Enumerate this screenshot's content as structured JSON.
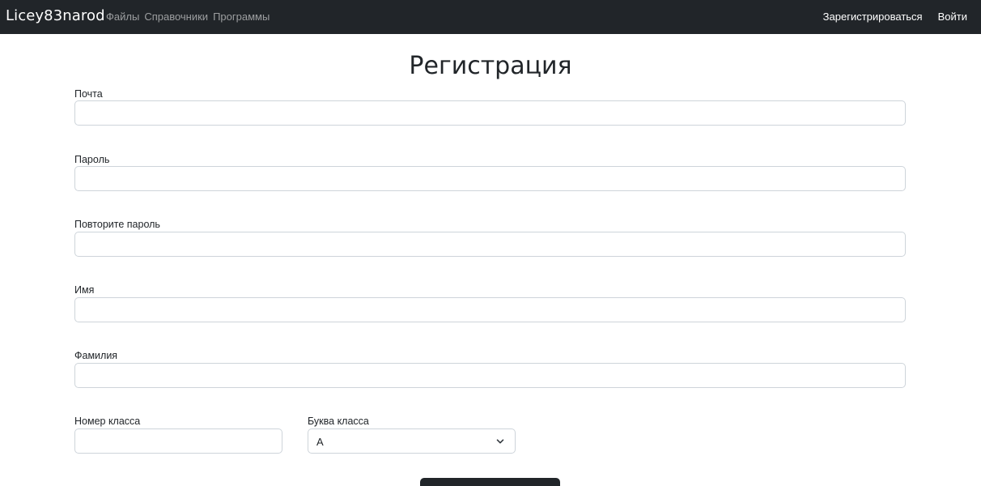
{
  "navbar": {
    "brand": "Licey83narod",
    "links": [
      "Файлы",
      "Справочники",
      "Программы"
    ],
    "register_label": "Зарегистрироваться",
    "login_label": "Войти"
  },
  "page": {
    "title": "Регистрация"
  },
  "form": {
    "email": {
      "label": "Почта",
      "value": ""
    },
    "password": {
      "label": "Пароль",
      "value": ""
    },
    "password_repeat": {
      "label": "Повторите пароль",
      "value": ""
    },
    "first_name": {
      "label": "Имя",
      "value": ""
    },
    "last_name": {
      "label": "Фамилия",
      "value": ""
    },
    "class_number": {
      "label": "Номер класса",
      "value": ""
    },
    "class_letter": {
      "label": "Буква класса",
      "selected": "А"
    }
  },
  "icons": {
    "select_arrow": "chevron-down-icon"
  },
  "colors": {
    "navbar_bg": "#212529",
    "input_border": "#ced4da",
    "nav_link_muted": "rgba(255,255,255,0.55)"
  }
}
